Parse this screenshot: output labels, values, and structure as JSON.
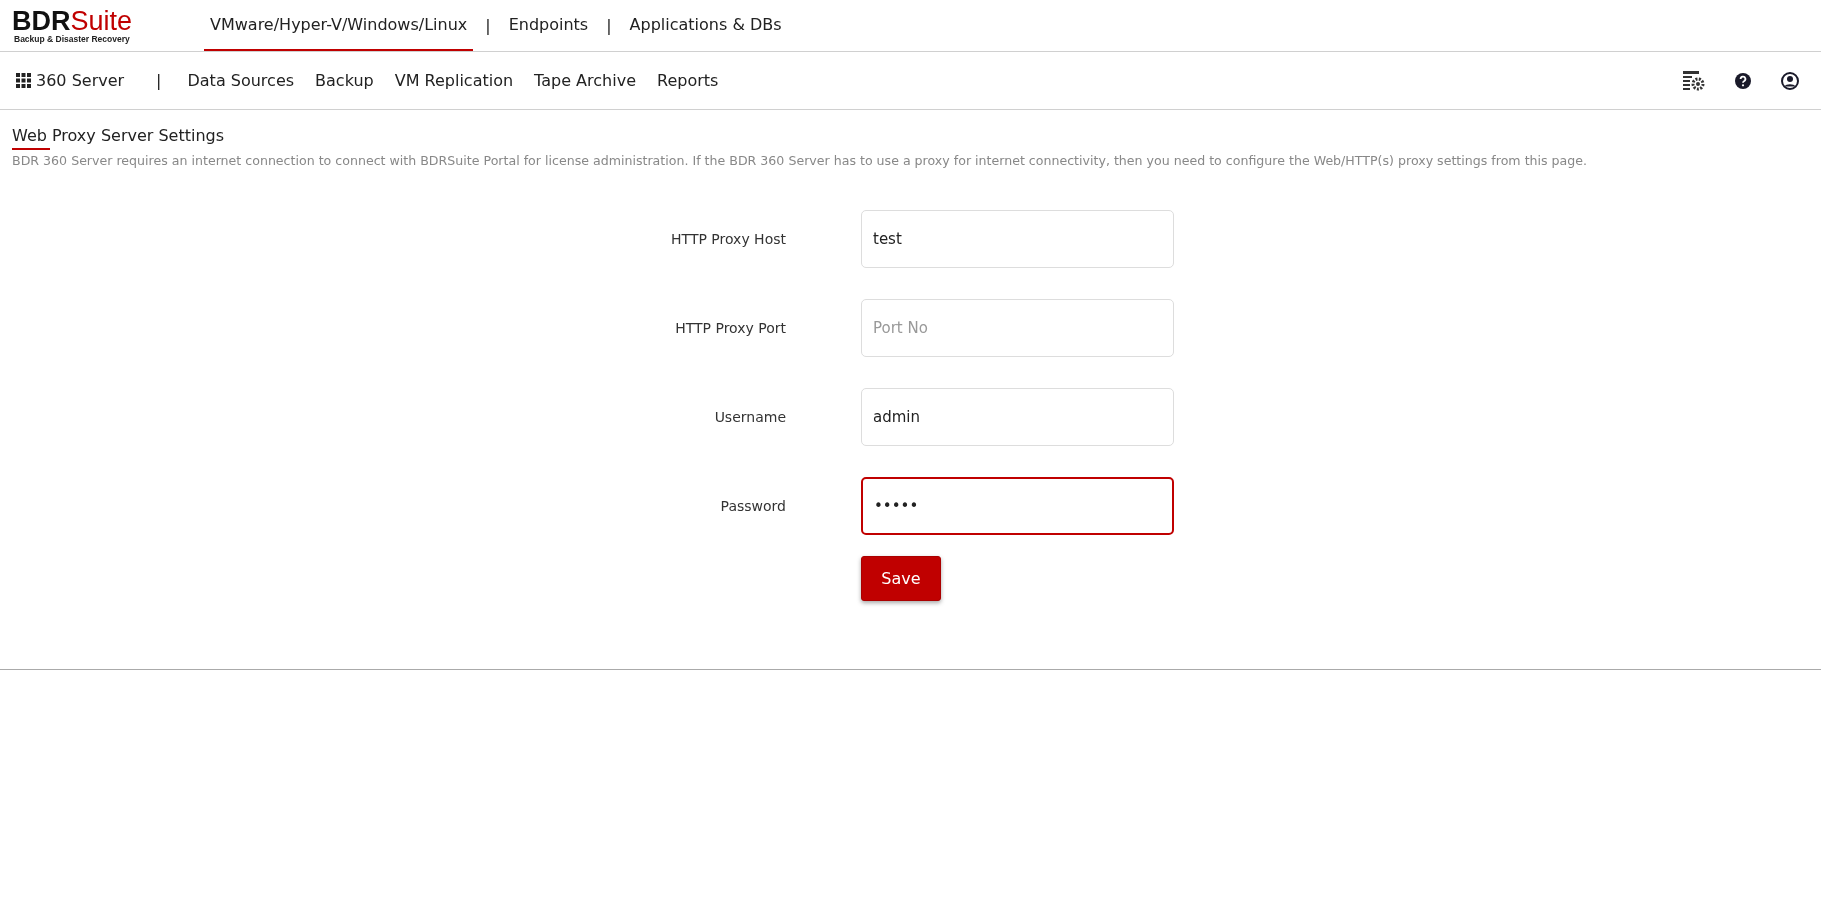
{
  "logo": {
    "brand": "BDR",
    "brand_accent": "Suite",
    "tagline": "Backup & Disaster Recovery"
  },
  "top_tabs": [
    {
      "label": "VMware/Hyper-V/Windows/Linux",
      "selected": true
    },
    {
      "label": "Endpoints",
      "selected": false
    },
    {
      "label": "Applications & DBs",
      "selected": false
    }
  ],
  "top_separator": "|",
  "sub_nav": {
    "server": "360 Server",
    "separator": "|",
    "items": [
      "Data Sources",
      "Backup",
      "VM Replication",
      "Tape Archive",
      "Reports"
    ]
  },
  "page": {
    "title": "Web Proxy Server Settings",
    "description": "BDR 360 Server requires an internet connection to connect with BDRSuite Portal for license administration. If the BDR 360 Server has to use a proxy for internet connectivity, then you need to configure the Web/HTTP(s) proxy settings from this page."
  },
  "form": [
    {
      "label": "HTTP Proxy Host",
      "value": "test",
      "focused": false
    },
    {
      "label": "HTTP Proxy Port",
      "placeholder": "Port No",
      "focused": false
    },
    {
      "label": "Username",
      "value": "admin",
      "focused": false
    },
    {
      "label": "Password",
      "value": "•••••",
      "focused": true
    }
  ],
  "save_button": "Save"
}
